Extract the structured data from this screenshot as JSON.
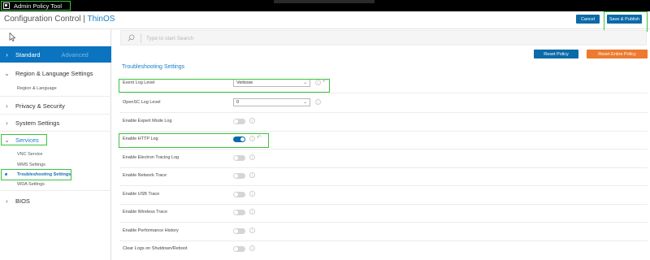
{
  "titlebar": {
    "app_name": "Admin Policy Tool"
  },
  "header": {
    "title": "Configuration Control",
    "separator": "|",
    "product": "ThinOS",
    "cancel_label": "Cancel",
    "save_label": "Save & Publish"
  },
  "search": {
    "placeholder": "Type to start Search"
  },
  "sidebar": {
    "tabs": {
      "standard": "Standard",
      "advanced": "Advanced"
    },
    "items": [
      {
        "label": "Region & Language Settings",
        "expanded": true,
        "children": [
          "Region & Language"
        ]
      },
      {
        "label": "Privacy & Security"
      },
      {
        "label": "System Settings"
      },
      {
        "label": "Services",
        "expanded": true,
        "children": [
          "VNC Service",
          "WMS Settings",
          "Troubleshooting Settings",
          "WDA Settings"
        ],
        "selected_child": "Troubleshooting Settings"
      },
      {
        "label": "BIOS"
      }
    ]
  },
  "actions": {
    "reset_policy": "Reset Policy",
    "reset_entire_policy": "Reset Entire Policy"
  },
  "section": {
    "title": "Troubleshooting Settings"
  },
  "settings": [
    {
      "label": "Event Log Level",
      "type": "dropdown",
      "value": "Verbose"
    },
    {
      "label": "OpenSC Log Level",
      "type": "dropdown",
      "value": "0"
    },
    {
      "label": "Enable Expert Mode Log",
      "type": "toggle",
      "on": false
    },
    {
      "label": "Enable HTTP Log",
      "type": "toggle",
      "on": true
    },
    {
      "label": "Enable Electron Tracing Log",
      "type": "toggle",
      "on": false
    },
    {
      "label": "Enable Network Trace",
      "type": "toggle",
      "on": false
    },
    {
      "label": "Enable USB Trace",
      "type": "toggle",
      "on": false
    },
    {
      "label": "Enable Wireless Trace",
      "type": "toggle",
      "on": false
    },
    {
      "label": "Enable Performance History",
      "type": "toggle",
      "on": false
    },
    {
      "label": "Clear Logs on Shutdown/Reboot",
      "type": "toggle",
      "on": false
    }
  ],
  "colors": {
    "accent": "#0b74c0",
    "primary_button": "#0b6aa8",
    "warning_button": "#ed7a2f",
    "highlight": "#3ec23e"
  }
}
